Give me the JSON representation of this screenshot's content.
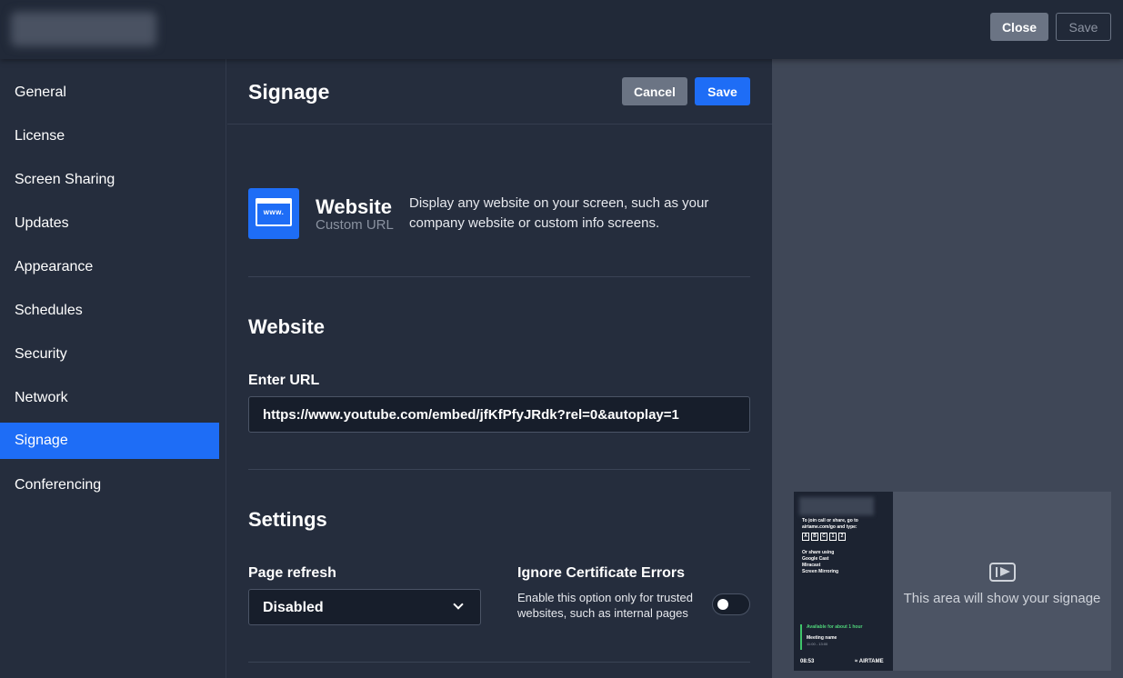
{
  "topbar": {
    "close_label": "Close",
    "save_label": "Save"
  },
  "sidebar": {
    "items": [
      {
        "label": "General"
      },
      {
        "label": "License"
      },
      {
        "label": "Screen Sharing"
      },
      {
        "label": "Updates"
      },
      {
        "label": "Appearance"
      },
      {
        "label": "Schedules"
      },
      {
        "label": "Security"
      },
      {
        "label": "Network"
      },
      {
        "label": "Signage",
        "active": true
      },
      {
        "label": "Conferencing"
      }
    ]
  },
  "header": {
    "title": "Signage",
    "cancel_label": "Cancel",
    "save_label": "Save"
  },
  "signage_type": {
    "icon": "website-icon",
    "icon_text": "www.",
    "title": "Website",
    "subtitle": "Custom URL",
    "description": "Display any website on your screen, such as your company website or custom info screens."
  },
  "website_section": {
    "title": "Website",
    "url_label": "Enter URL",
    "url_value": "https://www.youtube.com/embed/jfKfPfyJRdk?rel=0&autoplay=1"
  },
  "settings_section": {
    "title": "Settings",
    "page_refresh_label": "Page refresh",
    "page_refresh_value": "Disabled",
    "ignore_cert_label": "Ignore Certificate Errors",
    "ignore_cert_desc": "Enable this option only for trusted websites, such as internal pages",
    "ignore_cert_enabled": false
  },
  "preview": {
    "join_text": "To join call or share, go to airtame.com/go and type:",
    "code": [
      "A",
      "B",
      "C",
      "1",
      "2"
    ],
    "share_using": "Or share using",
    "share_methods": [
      "Google Cast",
      "Miracast",
      "Screen Mirroring"
    ],
    "availability": "Available for about 1 hour",
    "meeting_name": "Meeting name",
    "meeting_time": "11:00 - 13:00",
    "clock": "08:53",
    "brand": "≈ AIRTAME",
    "signage_placeholder": "This area will show your signage"
  },
  "colors": {
    "accent": "#1e6df6",
    "background": "#252d3d",
    "preview_bg": "#3f4757"
  }
}
